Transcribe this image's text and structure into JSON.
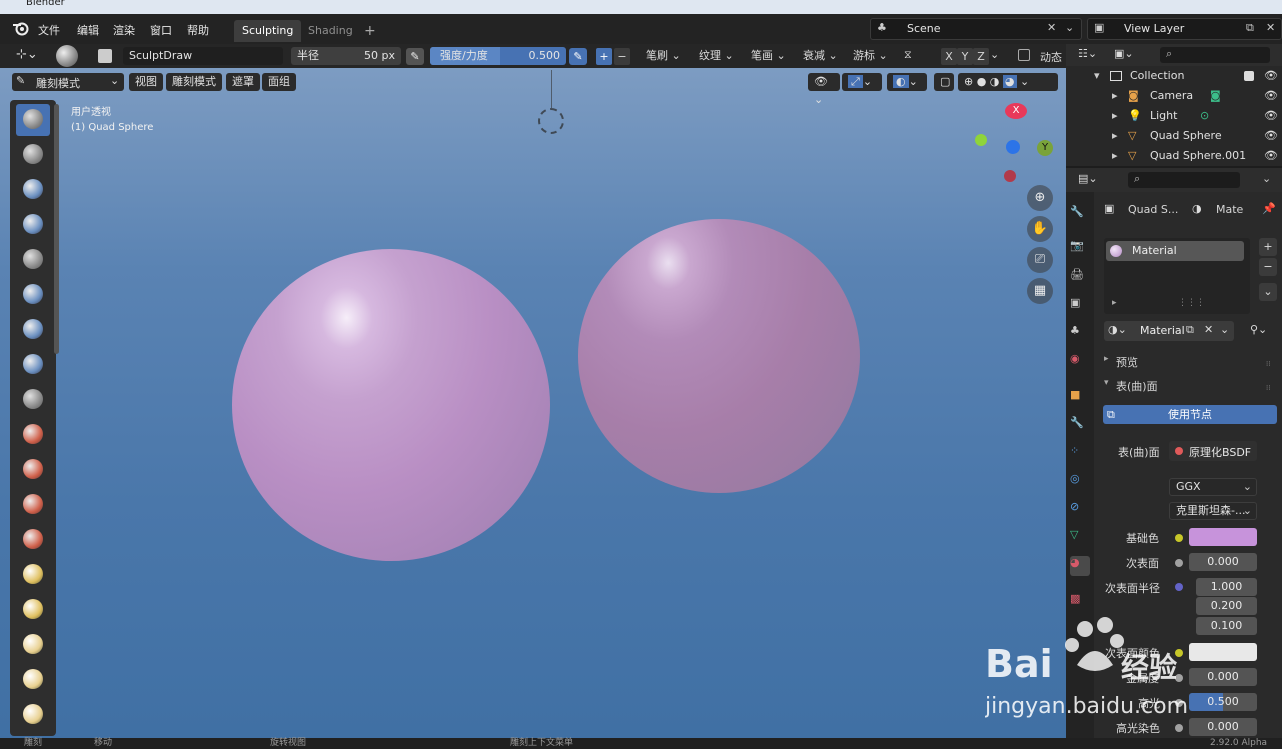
{
  "window": {
    "title": "Blender"
  },
  "menu": {
    "items": [
      "文件",
      "编辑",
      "渲染",
      "窗口",
      "帮助"
    ]
  },
  "workspaces": {
    "active": "Sculpting",
    "other": "Shading",
    "add": "+"
  },
  "scene": {
    "name": "Scene"
  },
  "view_layer": {
    "name": "View Layer"
  },
  "tool_header": {
    "brush_name": "SculptDraw",
    "radius_label": "半径",
    "radius_value": "50 px",
    "strength_label": "强度/力度",
    "strength_value": "0.500",
    "plus": "+",
    "minus": "−",
    "menus": [
      "笔刷",
      "纹理",
      "笔画",
      "衰减",
      "游标"
    ],
    "axes": [
      "X",
      "Y",
      "Z"
    ],
    "dynamic_label": "动态"
  },
  "viewport_header": {
    "mode": "雕刻模式",
    "menus": [
      "视图",
      "雕刻模式",
      "遮罩",
      "面组"
    ]
  },
  "viewport": {
    "perspective_label": "用户透视",
    "object_label": "(1) Quad Sphere",
    "gizmo": {
      "x": "X",
      "y": "Y"
    }
  },
  "outliner": {
    "collection": "Collection",
    "items": [
      {
        "name": "Camera"
      },
      {
        "name": "Light"
      },
      {
        "name": "Quad Sphere"
      },
      {
        "name": "Quad Sphere.001"
      }
    ]
  },
  "properties": {
    "context_object": "Quad S...",
    "context_material": "Mate",
    "slot_name": "Material",
    "material_name": "Material",
    "panels": {
      "preview": "预览",
      "surface": "表(曲)面"
    },
    "use_nodes_label": "使用节点",
    "surface_label": "表(曲)面",
    "surface_shader": "原理化BSDF",
    "distribution": "GGX",
    "subsurface_method": "克里斯坦森-...",
    "rows": [
      {
        "label": "基础色",
        "type": "color",
        "color": "#c793db"
      },
      {
        "label": "次表面",
        "value": "0.000"
      },
      {
        "label": "次表面半径",
        "values": [
          "1.000",
          "0.200",
          "0.100"
        ]
      },
      {
        "label": "次表面颜色",
        "type": "color",
        "color": "#e8e8e8"
      },
      {
        "label": "金属度",
        "value": "0.000"
      },
      {
        "label": "高光",
        "value": "0.500"
      },
      {
        "label": "高光染色",
        "value": "0.000"
      }
    ]
  },
  "status_bar": {
    "items": [
      "雕刻",
      "移动",
      "旋转视图",
      "雕刻上下文菜单"
    ],
    "version": "2.92.0 Alpha"
  },
  "watermark": {
    "logo": "Bai 经验",
    "url": "jingyan.baidu.com"
  },
  "colors": {
    "accent": "#4772b3",
    "material": "#c793db",
    "gizmo_x": "#e8395a",
    "gizmo_y": "#7aa33a",
    "gizmo_z": "#2c74e8"
  }
}
